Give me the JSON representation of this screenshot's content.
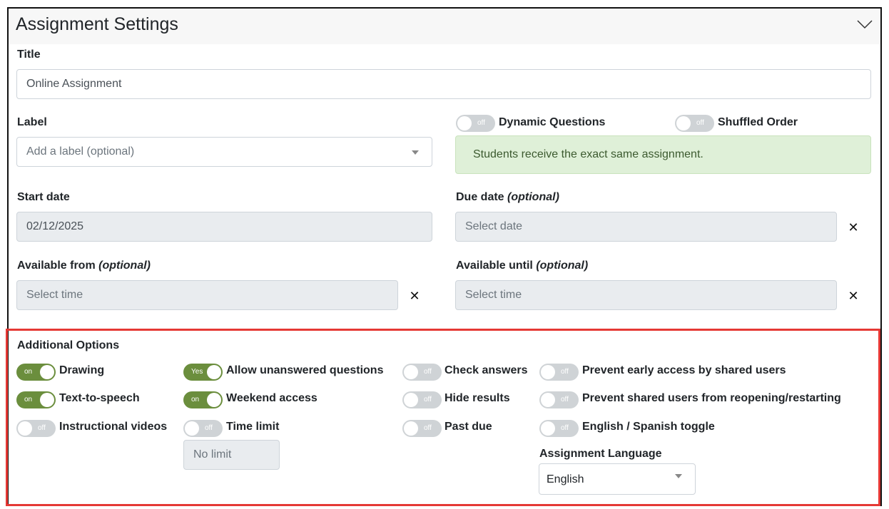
{
  "header": {
    "title": "Assignment Settings",
    "collapse_icon": "chevron-down-icon"
  },
  "title_field": {
    "label": "Title",
    "value": "Online Assignment"
  },
  "label_field": {
    "label": "Label",
    "placeholder": "Add a label (optional)"
  },
  "dynamic_questions": {
    "state": "off",
    "label": "Dynamic Questions"
  },
  "shuffled_order": {
    "state": "off",
    "label": "Shuffled Order"
  },
  "info_message": "Students receive the exact same assignment.",
  "start_date": {
    "label": "Start date",
    "value": "02/12/2025"
  },
  "due_date": {
    "label": "Due date",
    "optional": "(optional)",
    "placeholder": "Select date",
    "clear": "✕"
  },
  "available_from": {
    "label": "Available from",
    "optional": "(optional)",
    "placeholder": "Select time",
    "clear": "✕"
  },
  "available_until": {
    "label": "Available until",
    "optional": "(optional)",
    "placeholder": "Select time",
    "clear": "✕"
  },
  "additional_options": {
    "title": "Additional Options",
    "drawing": {
      "state": "on",
      "label": "Drawing"
    },
    "text_to_speech": {
      "state": "on",
      "label": "Text-to-speech"
    },
    "instructional_videos": {
      "state": "off",
      "label": "Instructional videos"
    },
    "allow_unanswered": {
      "state": "Yes",
      "label": "Allow unanswered questions"
    },
    "weekend_access": {
      "state": "on",
      "label": "Weekend access"
    },
    "time_limit": {
      "state": "off",
      "label": "Time limit",
      "value": "No limit"
    },
    "check_answers": {
      "state": "off",
      "label": "Check answers"
    },
    "hide_results": {
      "state": "off",
      "label": "Hide results"
    },
    "past_due": {
      "state": "off",
      "label": "Past due"
    },
    "prevent_early_access": {
      "state": "off",
      "label": "Prevent early access by shared users"
    },
    "prevent_reopening": {
      "state": "off",
      "label": "Prevent shared users from reopening/restarting"
    },
    "english_spanish_toggle": {
      "state": "off",
      "label": "English / Spanish toggle"
    },
    "assignment_language": {
      "label": "Assignment Language",
      "value": "English"
    }
  },
  "colors": {
    "toggle_on": "#6b8e3d",
    "toggle_off": "#cfd3d6",
    "highlight_border": "#e53935",
    "alert_bg": "#dff0d8"
  }
}
